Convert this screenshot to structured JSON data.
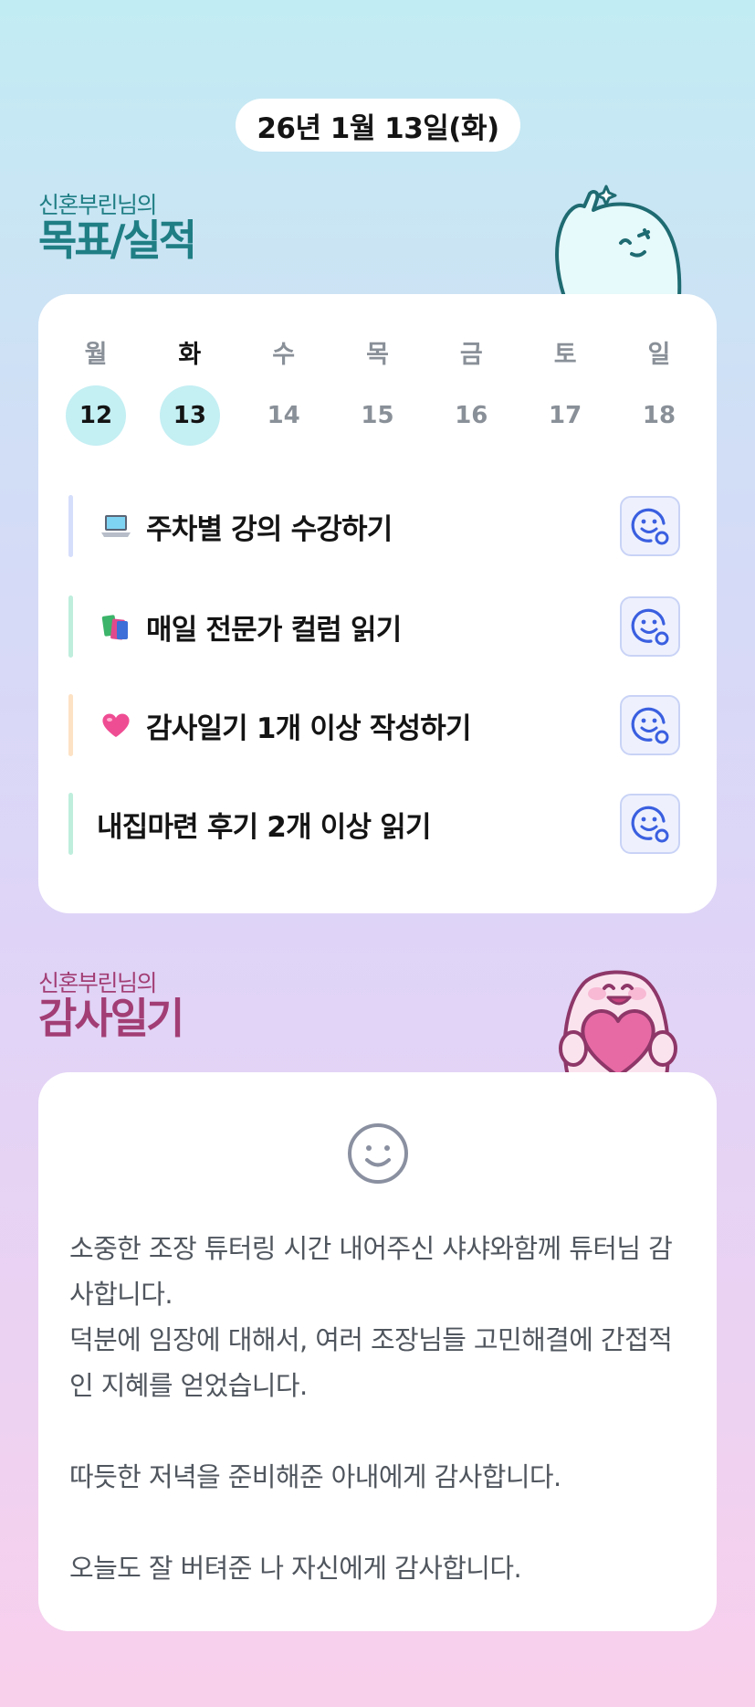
{
  "date_label": "26년 1월 13일(화)",
  "goals_section": {
    "subtitle": "신혼부린님의",
    "title": "목표/실적"
  },
  "week": [
    {
      "name": "월",
      "num": "12",
      "done": true,
      "today": false
    },
    {
      "name": "화",
      "num": "13",
      "done": true,
      "today": true
    },
    {
      "name": "수",
      "num": "14",
      "done": false,
      "today": false
    },
    {
      "name": "목",
      "num": "15",
      "done": false,
      "today": false
    },
    {
      "name": "금",
      "num": "16",
      "done": false,
      "today": false
    },
    {
      "name": "토",
      "num": "17",
      "done": false,
      "today": false
    },
    {
      "name": "일",
      "num": "18",
      "done": false,
      "today": false
    }
  ],
  "goals": [
    {
      "icon": "laptop-icon",
      "text": "주차별 강의 수강하기",
      "accent": "#d5defb"
    },
    {
      "icon": "books-icon",
      "text": "매일 전문가 컬럼 읽기",
      "accent": "#bfeedd"
    },
    {
      "icon": "heart-icon",
      "text": "감사일기 1개 이상 작성하기",
      "accent": "#fde2c4"
    },
    {
      "icon": "",
      "text": "내집마련 후기 2개 이상 읽기",
      "accent": "#bfeedd"
    }
  ],
  "diary_section": {
    "subtitle": "신혼부린님의",
    "title": "감사일기"
  },
  "diary": {
    "lines": [
      "소중한 조장 튜터링 시간 내어주신 샤샤와함께 튜터님 감사합니다.",
      "덕분에 임장에 대해서, 여러 조장님들 고민해결에 간접적인 지혜를 얻었습니다.",
      "",
      "따듯한 저녁을 준비해준 아내에게 감사합니다.",
      "",
      "오늘도 잘 버텨준 나 자신에게 감사합니다."
    ]
  },
  "colors": {
    "goals_accent": "#1f7e84",
    "diary_accent": "#a23e75",
    "done_circle": "#c4eff3",
    "react_icon": "#3a5fe0"
  }
}
